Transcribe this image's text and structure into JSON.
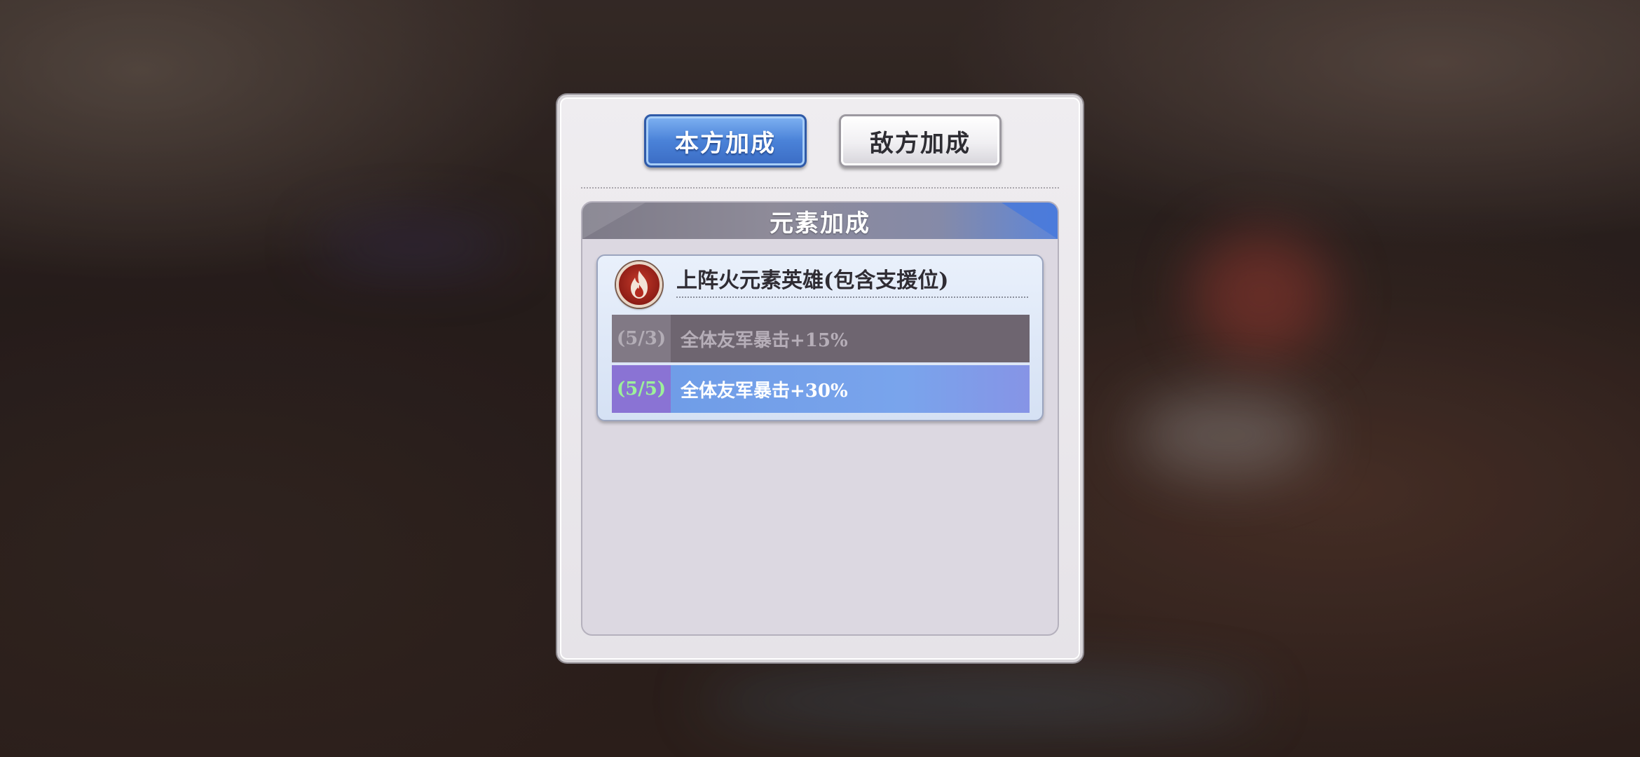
{
  "tabs": {
    "own_label": "本方加成",
    "enemy_label": "敌方加成",
    "selected": "own"
  },
  "panel": {
    "title": "元素加成"
  },
  "bonus_card": {
    "icon": "fire-element-icon",
    "condition": "上阵火元素英雄(包含支援位)",
    "tiers": [
      {
        "count": "(5/3)",
        "effect": "全体友军暴击+15%",
        "active": false
      },
      {
        "count": "(5/5)",
        "effect": "全体友军暴击+30%",
        "active": true
      }
    ]
  },
  "colors": {
    "selected_tab": "#4a82d8",
    "active_count": "#9df09a",
    "fire_icon": "#a8261c"
  }
}
